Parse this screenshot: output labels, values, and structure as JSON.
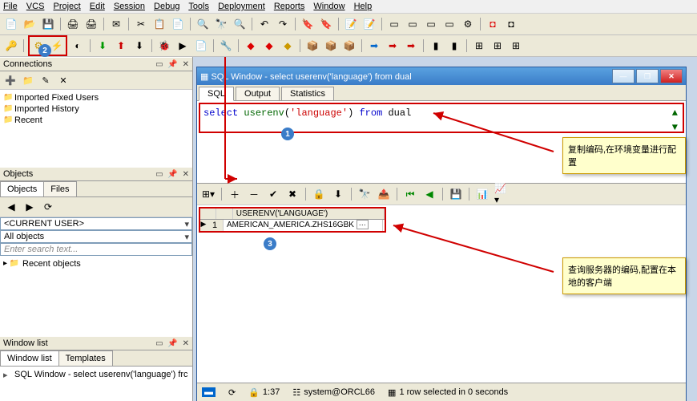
{
  "menu": {
    "file": "File",
    "edit": "Edit",
    "session": "Session",
    "debug": "Debug",
    "tools": "Tools",
    "deployment": "Deployment",
    "reports": "Reports",
    "window": "Window",
    "help": "Help",
    "vcs": "VCS",
    "project": "Project"
  },
  "panels": {
    "connections": "Connections",
    "objects": "Objects",
    "windowList": "Window list"
  },
  "connections": {
    "items": [
      "Imported Fixed Users",
      "Imported History",
      "Recent"
    ]
  },
  "objectsPanel": {
    "tabs": [
      "Objects",
      "Files"
    ],
    "currentUser": "<CURRENT USER>",
    "allObjects": "All objects",
    "searchPlaceholder": "Enter search text...",
    "recent": "Recent objects"
  },
  "windowListPanel": {
    "tabs": [
      "Window list",
      "Templates"
    ],
    "items": [
      "SQL Window - select userenv('language') frc"
    ]
  },
  "sqlWindow": {
    "title": "SQL Window - select userenv('language') from dual",
    "tabs": [
      "SQL",
      "Output",
      "Statistics"
    ],
    "query": {
      "pre": "select ",
      "fn": "userenv",
      "open": "(",
      "arg": "'language'",
      "close": ") ",
      "kw2": "from ",
      "tbl": "dual"
    },
    "resultHeader": "USERENV('LANGUAGE')",
    "resultRowNum": "1",
    "resultValue": "AMERICAN_AMERICA.ZHS16GBK",
    "ellipsis": "···"
  },
  "callouts": {
    "top": "复制编码,在环境变量进行配置",
    "bottom": "查询服务器的编码,配置在本地的客户端"
  },
  "numbers": {
    "n1": "1",
    "n2": "2",
    "n3": "3"
  },
  "status": {
    "time": "1:37",
    "conn": "system@ORCL66",
    "rows": "1 row selected in 0 seconds",
    "refresh": "⟳",
    "lock": "🔒",
    "net": "☷"
  },
  "icons": {
    "minimize": "—",
    "maximize": "❐",
    "close": "✕",
    "pin": "📌",
    "dock": "▭",
    "x": "✕"
  },
  "chart_data": {
    "type": "table",
    "headers": [
      "USERENV('LANGUAGE')"
    ],
    "rows": [
      [
        "AMERICAN_AMERICA.ZHS16GBK"
      ]
    ]
  }
}
